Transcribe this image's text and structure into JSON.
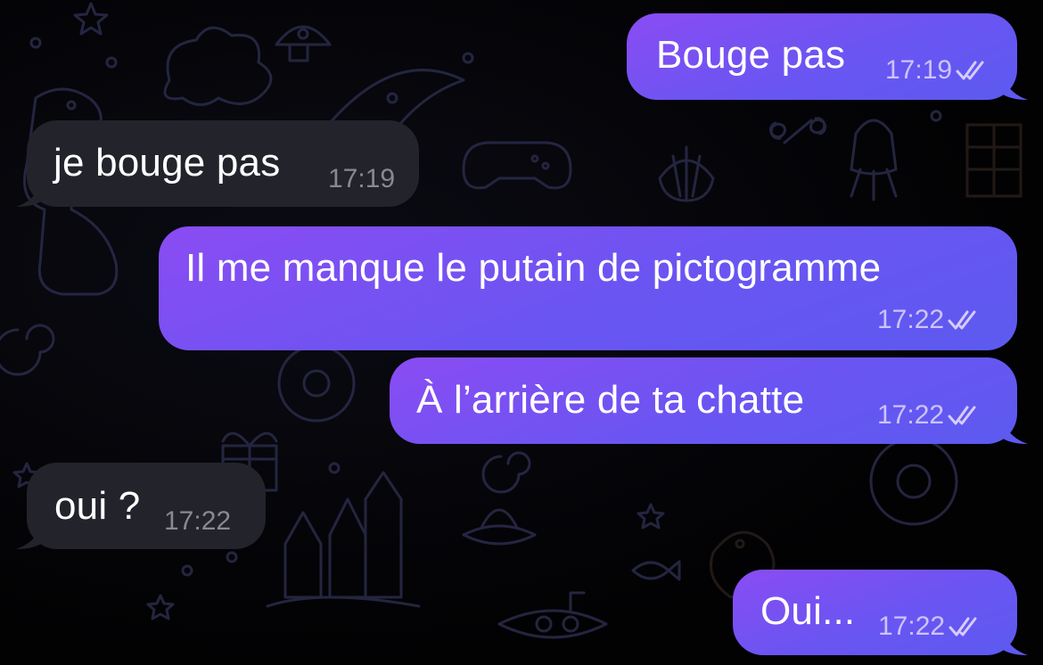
{
  "chat": {
    "messages": [
      {
        "direction": "outgoing",
        "text": "Bouge pas",
        "time": "17:19",
        "status": "read"
      },
      {
        "direction": "incoming",
        "text": "je bouge pas",
        "time": "17:19"
      },
      {
        "direction": "outgoing",
        "text": "Il me manque le putain de pictogramme",
        "time": "17:22",
        "status": "read"
      },
      {
        "direction": "outgoing",
        "text": "À l’arrière de ta chatte",
        "time": "17:22",
        "status": "read"
      },
      {
        "direction": "incoming",
        "text": "oui ?",
        "time": "17:22"
      },
      {
        "direction": "outgoing",
        "text": "Oui...",
        "time": "17:22",
        "status": "read"
      }
    ]
  },
  "colors": {
    "outgoing_bubble_start": "#8a4cf3",
    "outgoing_bubble_end": "#5c5af0",
    "incoming_bubble": "#22232b",
    "background": "#020203"
  },
  "icons": {
    "read_status": "double-check-icon",
    "wallpaper": "doodle-pattern"
  }
}
